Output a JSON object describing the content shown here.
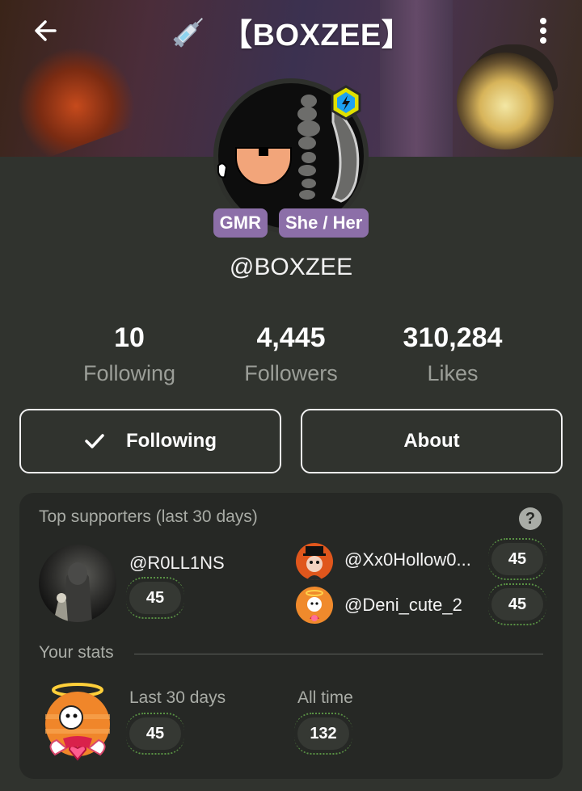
{
  "header": {
    "title": "【BOXZEE】",
    "back_icon": "arrow-left-icon",
    "menu_icon": "more-vertical-icon",
    "title_icon": "syringe-icon"
  },
  "profile": {
    "badges": [
      "GMR",
      "She / Her"
    ],
    "handle": "@BOXZEE"
  },
  "stats": [
    {
      "value": "10",
      "label": "Following"
    },
    {
      "value": "4,445",
      "label": "Followers"
    },
    {
      "value": "310,284",
      "label": "Likes"
    }
  ],
  "buttons": {
    "following_label": "Following",
    "about_label": "About"
  },
  "supporters": {
    "title": "Top supporters (last 30 days)",
    "help": "?",
    "top": {
      "name": "@R0LL1NS",
      "count": "45"
    },
    "others": [
      {
        "name": "@Xx0Hollow0...",
        "count": "45"
      },
      {
        "name": "@Deni_cute_2",
        "count": "45"
      }
    ]
  },
  "your_stats": {
    "title": "Your stats",
    "last30_label": "Last 30 days",
    "last30_value": "45",
    "alltime_label": "All time",
    "alltime_value": "132"
  },
  "colors": {
    "background": "#30332e",
    "card": "#262825",
    "badge": "#8c6fa8",
    "muted_text": "#9b9e98",
    "accent_green": "#6fbf52"
  }
}
